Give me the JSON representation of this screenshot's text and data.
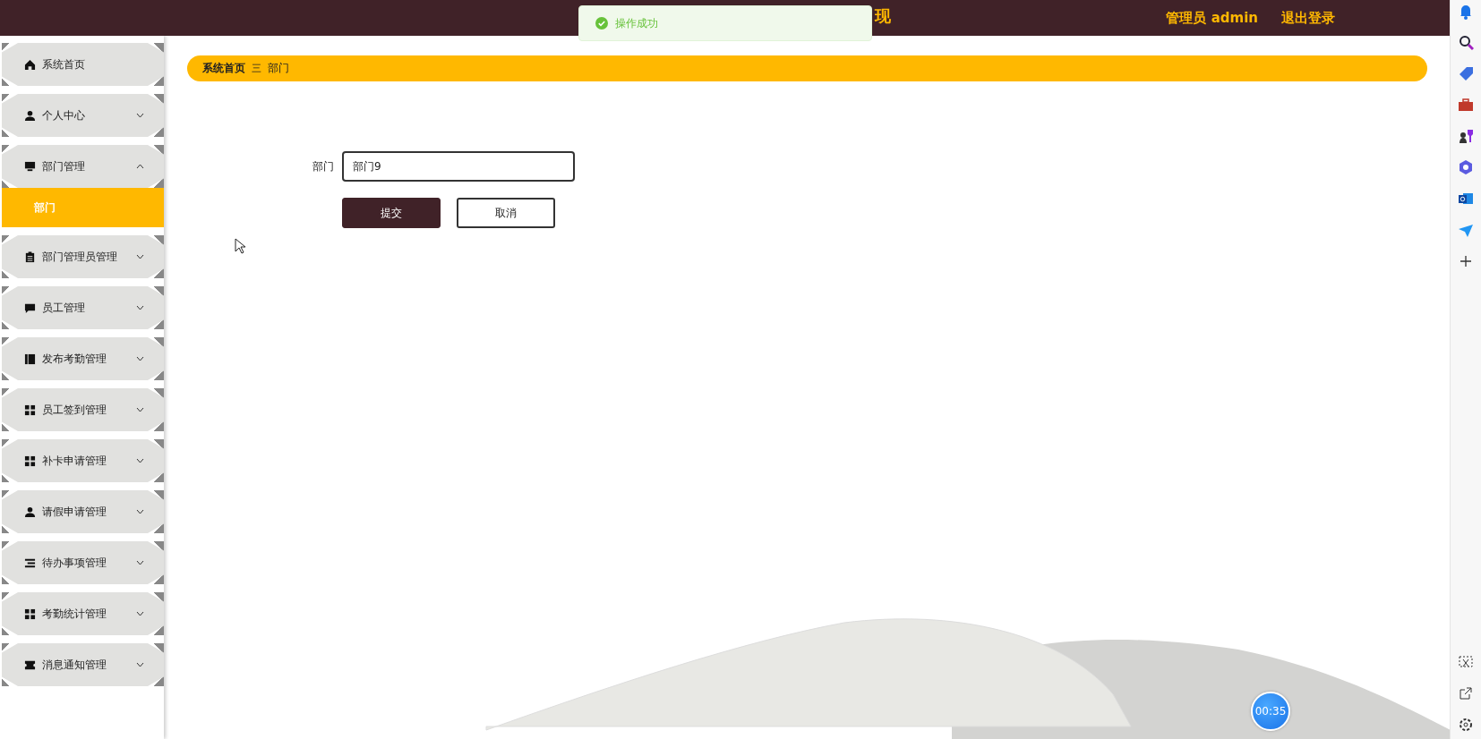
{
  "header": {
    "title_fragment": "现",
    "user": "管理员 admin",
    "logout": "退出登录"
  },
  "toast": {
    "text": "操作成功"
  },
  "sidebar": {
    "items": [
      {
        "label": "系统首页",
        "kind": "link"
      },
      {
        "label": "个人中心",
        "kind": "menu",
        "expanded": false
      },
      {
        "label": "部门管理",
        "kind": "menu",
        "expanded": true,
        "children": [
          {
            "label": "部门",
            "selected": true
          }
        ]
      },
      {
        "label": "部门管理员管理",
        "kind": "menu",
        "expanded": false
      },
      {
        "label": "员工管理",
        "kind": "menu",
        "expanded": false
      },
      {
        "label": "发布考勤管理",
        "kind": "menu",
        "expanded": false
      },
      {
        "label": "员工签到管理",
        "kind": "menu",
        "expanded": false
      },
      {
        "label": "补卡申请管理",
        "kind": "menu",
        "expanded": false
      },
      {
        "label": "请假申请管理",
        "kind": "menu",
        "expanded": false
      },
      {
        "label": "待办事项管理",
        "kind": "menu",
        "expanded": false
      },
      {
        "label": "考勤统计管理",
        "kind": "menu",
        "expanded": false
      },
      {
        "label": "消息通知管理",
        "kind": "menu",
        "expanded": false
      }
    ]
  },
  "breadcrumb": {
    "items": [
      "系统首页",
      "部门"
    ],
    "separator": "三"
  },
  "form": {
    "fields": [
      {
        "label": "部门",
        "value": "部门9"
      }
    ],
    "buttons": [
      {
        "label": "提交",
        "kind": "primary"
      },
      {
        "label": "取消",
        "kind": "secondary"
      }
    ]
  },
  "timer": "00:35"
}
